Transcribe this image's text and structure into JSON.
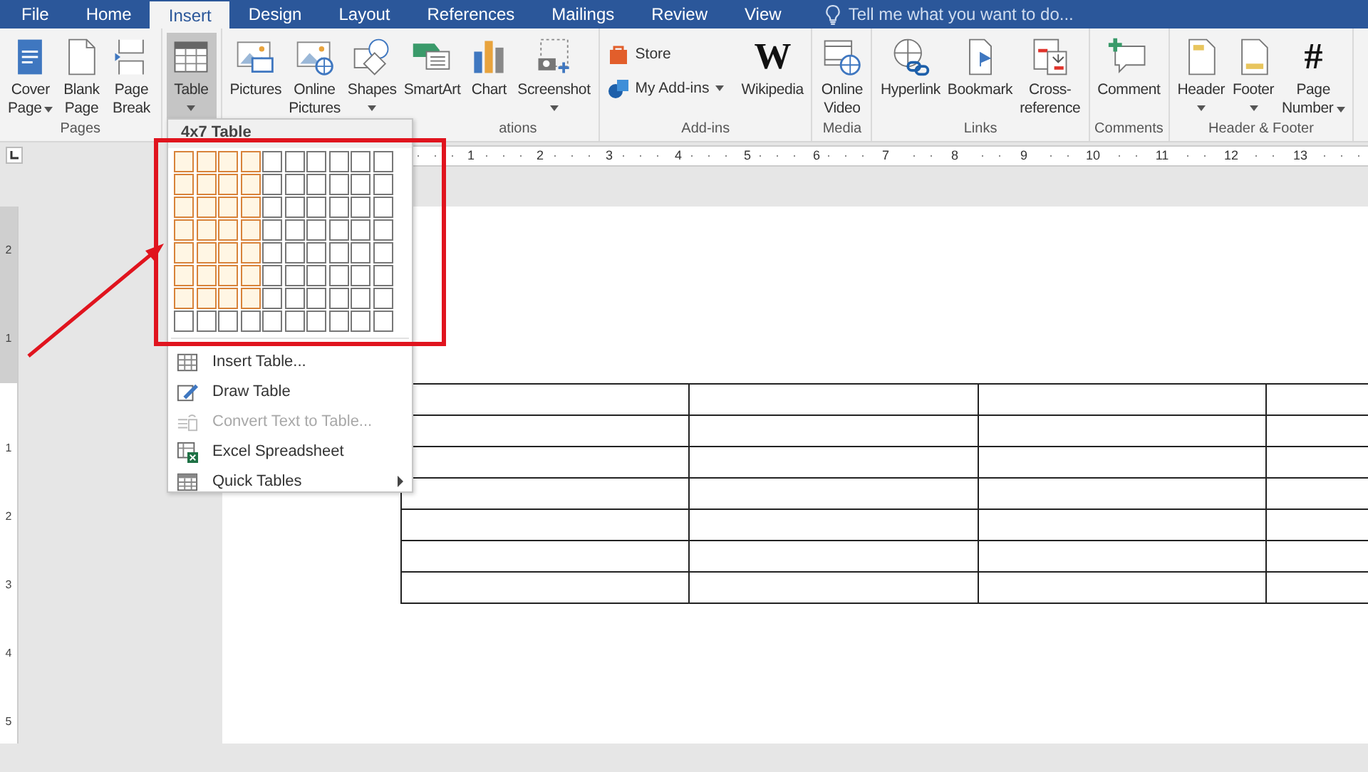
{
  "tabs": [
    {
      "label": "File",
      "selected": false
    },
    {
      "label": "Home",
      "selected": false
    },
    {
      "label": "Insert",
      "selected": true
    },
    {
      "label": "Design",
      "selected": false
    },
    {
      "label": "Layout",
      "selected": false
    },
    {
      "label": "References",
      "selected": false
    },
    {
      "label": "Mailings",
      "selected": false
    },
    {
      "label": "Review",
      "selected": false
    },
    {
      "label": "View",
      "selected": false
    }
  ],
  "tell_me": {
    "placeholder": "Tell me what you want to do..."
  },
  "ribbon": {
    "groups": [
      {
        "label": "Pages",
        "buttons": [
          {
            "kind": "large",
            "label": [
              "Cover",
              "Page"
            ],
            "menu": true,
            "pressed": false
          },
          {
            "kind": "large",
            "label": [
              "Blank",
              "Page"
            ],
            "menu": false,
            "pressed": false
          },
          {
            "kind": "large",
            "label": [
              "Page",
              "Break"
            ],
            "menu": false,
            "pressed": false
          }
        ]
      },
      {
        "buttons": [
          {
            "kind": "large",
            "label": [
              "Table"
            ],
            "menu": true,
            "pressed": true
          }
        ]
      },
      {
        "label": "ations",
        "buttons": [
          {
            "kind": "large",
            "label": [
              "Pictures"
            ],
            "menu": false,
            "pressed": false
          },
          {
            "kind": "large",
            "label": [
              "Online",
              "Pictures"
            ],
            "menu": false,
            "pressed": false
          },
          {
            "kind": "large",
            "label": [
              "Shapes"
            ],
            "menu": true,
            "pressed": false
          },
          {
            "kind": "large",
            "label": [
              "SmartArt"
            ],
            "menu": false,
            "pressed": false
          },
          {
            "kind": "large",
            "label": [
              "Chart"
            ],
            "menu": false,
            "pressed": false
          },
          {
            "kind": "large",
            "label": [
              "Screenshot"
            ],
            "menu": true,
            "pressed": false
          }
        ]
      },
      {
        "label": "Add-ins",
        "buttons": [
          {
            "kind": "small",
            "label": [
              "Store"
            ],
            "menu": false,
            "pressed": false
          },
          {
            "kind": "small",
            "label": [
              "My Add-ins"
            ],
            "menu": true,
            "pressed": false
          },
          {
            "kind": "large",
            "label": [
              "Wikipedia"
            ],
            "glyph": "W",
            "menu": false,
            "pressed": false
          }
        ]
      },
      {
        "label": "Media",
        "buttons": [
          {
            "kind": "large",
            "label": [
              "Online",
              "Video"
            ],
            "menu": false,
            "pressed": false
          }
        ]
      },
      {
        "label": "Links",
        "buttons": [
          {
            "kind": "large",
            "label": [
              "Hyperlink"
            ],
            "menu": false,
            "pressed": false
          },
          {
            "kind": "large",
            "label": [
              "Bookmark"
            ],
            "menu": false,
            "pressed": false
          },
          {
            "kind": "large",
            "label": [
              "Cross-",
              "reference"
            ],
            "menu": false,
            "pressed": false
          }
        ]
      },
      {
        "label": "Comments",
        "buttons": [
          {
            "kind": "large",
            "label": [
              "Comment"
            ],
            "menu": false,
            "pressed": false
          }
        ]
      },
      {
        "label": "Header & Footer",
        "buttons": [
          {
            "kind": "large",
            "label": [
              "Header"
            ],
            "menu": true,
            "pressed": false
          },
          {
            "kind": "large",
            "label": [
              "Footer"
            ],
            "menu": true,
            "pressed": false
          },
          {
            "kind": "large",
            "label": [
              "Page",
              "Number"
            ],
            "glyph": "#",
            "menu": true,
            "pressed": false
          }
        ]
      }
    ]
  },
  "ruler": {
    "marks": [
      "1",
      "2",
      "3",
      "4",
      "5",
      "6",
      "7",
      "8",
      "9",
      "10",
      "11",
      "12",
      "13"
    ]
  },
  "vertical_ruler": {
    "above": [
      "2",
      "1"
    ],
    "below": [
      "1",
      "2",
      "3",
      "4",
      "5"
    ]
  },
  "table_menu": {
    "title": "4x7 Table",
    "grid": [
      {
        "cells": [
          {
            "selected": true
          },
          {
            "selected": true
          },
          {
            "selected": true
          },
          {
            "selected": true
          },
          {
            "selected": false
          },
          {
            "selected": false
          },
          {
            "selected": false
          },
          {
            "selected": false
          },
          {
            "selected": false
          },
          {
            "selected": false
          }
        ]
      },
      {
        "cells": [
          {
            "selected": true
          },
          {
            "selected": true
          },
          {
            "selected": true
          },
          {
            "selected": true
          },
          {
            "selected": false
          },
          {
            "selected": false
          },
          {
            "selected": false
          },
          {
            "selected": false
          },
          {
            "selected": false
          },
          {
            "selected": false
          }
        ]
      },
      {
        "cells": [
          {
            "selected": true
          },
          {
            "selected": true
          },
          {
            "selected": true
          },
          {
            "selected": true
          },
          {
            "selected": false
          },
          {
            "selected": false
          },
          {
            "selected": false
          },
          {
            "selected": false
          },
          {
            "selected": false
          },
          {
            "selected": false
          }
        ]
      },
      {
        "cells": [
          {
            "selected": true
          },
          {
            "selected": true
          },
          {
            "selected": true
          },
          {
            "selected": true
          },
          {
            "selected": false
          },
          {
            "selected": false
          },
          {
            "selected": false
          },
          {
            "selected": false
          },
          {
            "selected": false
          },
          {
            "selected": false
          }
        ]
      },
      {
        "cells": [
          {
            "selected": true
          },
          {
            "selected": true
          },
          {
            "selected": true
          },
          {
            "selected": true
          },
          {
            "selected": false
          },
          {
            "selected": false
          },
          {
            "selected": false
          },
          {
            "selected": false
          },
          {
            "selected": false
          },
          {
            "selected": false
          }
        ]
      },
      {
        "cells": [
          {
            "selected": true
          },
          {
            "selected": true
          },
          {
            "selected": true
          },
          {
            "selected": true
          },
          {
            "selected": false
          },
          {
            "selected": false
          },
          {
            "selected": false
          },
          {
            "selected": false
          },
          {
            "selected": false
          },
          {
            "selected": false
          }
        ]
      },
      {
        "cells": [
          {
            "selected": true
          },
          {
            "selected": true
          },
          {
            "selected": true
          },
          {
            "selected": true
          },
          {
            "selected": false
          },
          {
            "selected": false
          },
          {
            "selected": false
          },
          {
            "selected": false
          },
          {
            "selected": false
          },
          {
            "selected": false
          }
        ]
      },
      {
        "cells": [
          {
            "selected": false
          },
          {
            "selected": false
          },
          {
            "selected": false
          },
          {
            "selected": false
          },
          {
            "selected": false
          },
          {
            "selected": false
          },
          {
            "selected": false
          },
          {
            "selected": false
          },
          {
            "selected": false
          },
          {
            "selected": false
          }
        ]
      }
    ],
    "items": [
      {
        "label": "Insert Table...",
        "disabled": false,
        "submenu": false
      },
      {
        "label": "Draw Table",
        "disabled": false,
        "submenu": false
      },
      {
        "label": "Convert Text to Table...",
        "disabled": true,
        "submenu": false
      },
      {
        "label": "Excel Spreadsheet",
        "disabled": false,
        "submenu": false
      },
      {
        "label": "Quick Tables",
        "disabled": false,
        "submenu": true
      }
    ]
  }
}
